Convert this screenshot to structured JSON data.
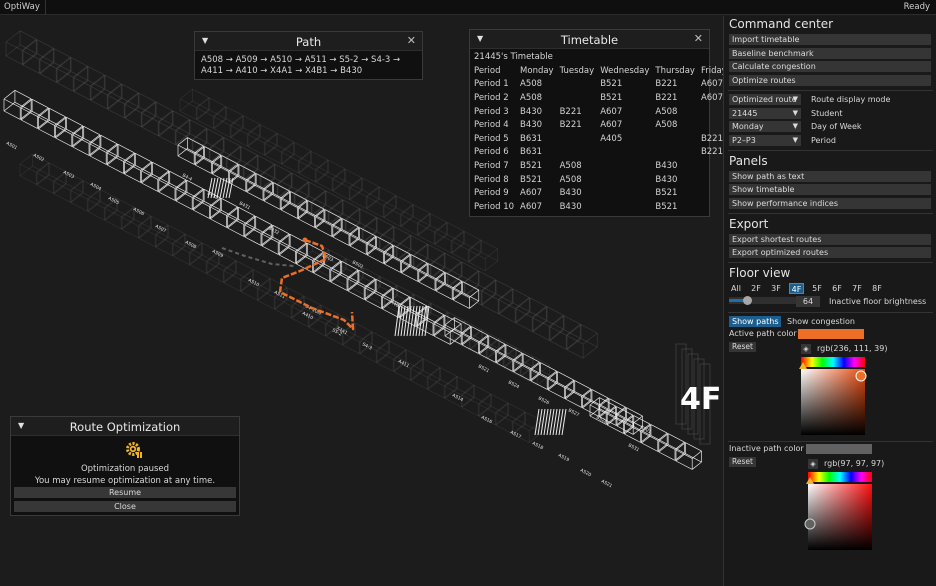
{
  "app": {
    "title": "OptiWay",
    "status": "Ready"
  },
  "viewport": {
    "floor_label": "4F",
    "rooms": [
      "A501",
      "A502",
      "A503",
      "A504",
      "A505",
      "A506",
      "A507",
      "A508",
      "A509",
      "A510",
      "A511",
      "B4-10M",
      "B4-4",
      "B430",
      "B431",
      "B432",
      "S5-2",
      "S4-3",
      "A411",
      "A410",
      "X4A1",
      "X4B1",
      "B521",
      "B524",
      "B526",
      "B527",
      "B528",
      "B531",
      "A514",
      "A516",
      "A517",
      "A518",
      "A519",
      "A520",
      "A521",
      "B501",
      "B502",
      "B503"
    ],
    "active_path_color": "#ec6f27",
    "inactive_path_color": "#616161"
  },
  "path_panel": {
    "title": "Path",
    "text": "A508 → A509 → A510 → A511 → S5-2 → S4-3 → A411 → A410 → X4A1 → X4B1 → B430"
  },
  "timetable_panel": {
    "title": "Timetable",
    "caption": "21445's Timetable",
    "headers": [
      "Period",
      "Monday",
      "Tuesday",
      "Wednesday",
      "Thursday",
      "Friday"
    ],
    "rows": [
      [
        "Period 1",
        "A508",
        "",
        "B521",
        "B221",
        "A607"
      ],
      [
        "Period 2",
        "A508",
        "",
        "B521",
        "B221",
        "A607"
      ],
      [
        "Period 3",
        "B430",
        "B221",
        "A607",
        "A508",
        ""
      ],
      [
        "Period 4",
        "B430",
        "B221",
        "A607",
        "A508",
        ""
      ],
      [
        "Period 5",
        "B631",
        "",
        "A405",
        "",
        "B221"
      ],
      [
        "Period 6",
        "B631",
        "",
        "",
        "",
        "B221"
      ],
      [
        "Period 7",
        "B521",
        "A508",
        "",
        "B430",
        ""
      ],
      [
        "Period 8",
        "B521",
        "A508",
        "",
        "B430",
        ""
      ],
      [
        "Period 9",
        "A607",
        "B430",
        "",
        "B521",
        ""
      ],
      [
        "Period 10",
        "A607",
        "B430",
        "",
        "B521",
        ""
      ]
    ]
  },
  "route_panel": {
    "title": "Route Optimization",
    "status_line": "Optimization paused",
    "hint_line": "You may resume optimization at any time.",
    "resume_label": "Resume",
    "close_label": "Close",
    "accent_color": "#f0b429"
  },
  "sidebar": {
    "command_center": {
      "heading": "Command center",
      "buttons": [
        "Import timetable",
        "Baseline benchmark",
        "Calculate congestion",
        "Optimize routes"
      ]
    },
    "route_mode": {
      "value": "Optimized route",
      "label": "Route display mode"
    },
    "student": {
      "value": "21445",
      "label": "Student"
    },
    "day": {
      "value": "Monday",
      "label": "Day of Week"
    },
    "period": {
      "value": "P2–P3",
      "label": "Period"
    },
    "panels": {
      "heading": "Panels",
      "buttons": [
        "Show path as text",
        "Show timetable",
        "Show performance indices"
      ]
    },
    "export": {
      "heading": "Export",
      "buttons": [
        "Export shortest routes",
        "Export optimized routes"
      ]
    },
    "floor_view": {
      "heading": "Floor view",
      "floors": [
        "All",
        "2F",
        "3F",
        "4F",
        "5F",
        "6F",
        "7F",
        "8F"
      ],
      "active_floor": "4F",
      "brightness_value": "64",
      "brightness_fraction": 0.25,
      "brightness_label": "Inactive floor brightness"
    },
    "paths_tab": "Show paths",
    "congestion_tab": "Show congestion",
    "active_color": {
      "label": "Active path color",
      "reset": "Reset",
      "rgb_text": "rgb(236, 111, 39)",
      "hex": "#ec6f27"
    },
    "inactive_color": {
      "label": "Inactive path color",
      "reset": "Reset",
      "rgb_text": "rgb(97, 97, 97)",
      "hex": "#616161"
    },
    "accent": "#1c5e8d"
  }
}
